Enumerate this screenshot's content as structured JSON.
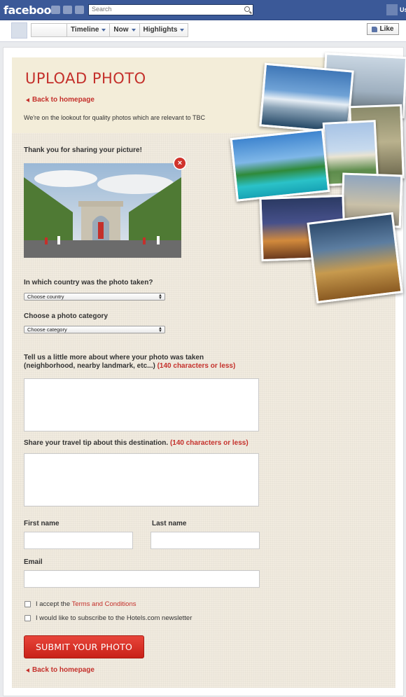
{
  "facebook": {
    "logo": "facebook",
    "search_placeholder": "Search",
    "user_label": "Us"
  },
  "page_nav": {
    "items": [
      "Timeline",
      "Now",
      "Highlights"
    ],
    "like_label": "Like"
  },
  "app": {
    "title": "UPLOAD PHOTO",
    "back_link": "Back to homepage",
    "intro": "We're on the lookout for quality photos which are relevant to TBC",
    "thanks": "Thank you for sharing your picture!",
    "country_question": "In which country was the photo taken?",
    "country_select": "Choose country",
    "category_question": "Choose a photo category",
    "category_select": "Choose category",
    "location_question": "Tell us a little more about where your photo was taken",
    "location_question_2": "(neighborhood, nearby landmark, etc...)",
    "char_limit": "(140 characters or less)",
    "tip_question": "Share your travel tip about this destination.",
    "first_name": "First name",
    "last_name": "Last name",
    "email": "Email",
    "accept_prefix": "I accept the",
    "terms_link": "Terms and Conditions",
    "newsletter": "I would like to subscribe to the Hotels.com newsletter",
    "submit": "SUBMIT YOUR PHOTO",
    "bottom_back_link": "Back to homepage"
  },
  "colors": {
    "facebook_blue": "#3b5998",
    "accent_red": "#c4302b",
    "paper": "#f1ebdf"
  }
}
